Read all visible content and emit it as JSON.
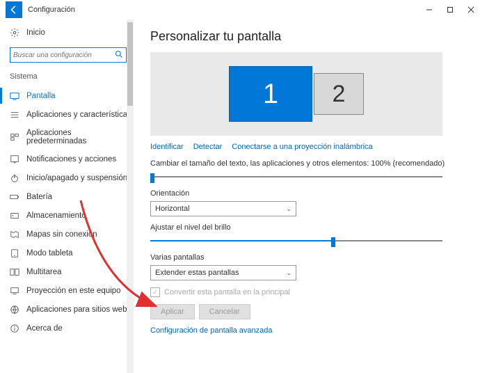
{
  "window": {
    "title": "Configuración"
  },
  "sidebar": {
    "home_label": "Inicio",
    "search_placeholder": "Buscar una configuración",
    "section_label": "Sistema",
    "items": [
      {
        "label": "Pantalla"
      },
      {
        "label": "Aplicaciones y características"
      },
      {
        "label": "Aplicaciones predeterminadas"
      },
      {
        "label": "Notificaciones y acciones"
      },
      {
        "label": "Inicio/apagado y suspensión"
      },
      {
        "label": "Batería"
      },
      {
        "label": "Almacenamiento"
      },
      {
        "label": "Mapas sin conexión"
      },
      {
        "label": "Modo tableta"
      },
      {
        "label": "Multitarea"
      },
      {
        "label": "Proyección en este equipo"
      },
      {
        "label": "Aplicaciones para sitios web"
      },
      {
        "label": "Acerca de"
      }
    ]
  },
  "main": {
    "heading": "Personalizar tu pantalla",
    "monitor1": "1",
    "monitor2": "2",
    "link_identify": "Identificar",
    "link_detect": "Detectar",
    "link_wireless": "Conectarse a una proyección inalámbrica",
    "scale_label": "Cambiar el tamaño del texto, las aplicaciones y otros elementos: 100% (recomendado)",
    "orientation_label": "Orientación",
    "orientation_value": "Horizontal",
    "brightness_label": "Ajustar el nivel del brillo",
    "multi_label": "Varias pantallas",
    "multi_value": "Extender estas pantallas",
    "checkbox_label": "Convertir esta pantalla en la principal",
    "apply": "Aplicar",
    "cancel": "Cancelar",
    "advanced": "Configuración de pantalla avanzada"
  }
}
